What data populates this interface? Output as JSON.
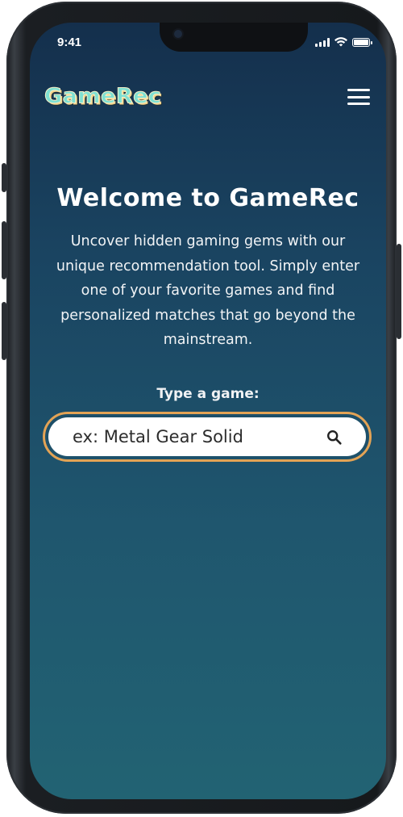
{
  "status_bar": {
    "time": "9:41"
  },
  "header": {
    "logo": "GameRec",
    "menu_icon": "hamburger-menu-icon"
  },
  "hero": {
    "title": "Welcome to GameRec",
    "description": "Uncover hidden gaming gems with our unique recommendation tool. Simply enter one of your favorite games and find personalized matches that go beyond the mainstream."
  },
  "search": {
    "label": "Type a game:",
    "placeholder": "ex: Metal Gear Solid",
    "icon": "search-icon"
  },
  "colors": {
    "background_top": "#142f4c",
    "background_bottom": "#226373",
    "search_border": "#e3a355",
    "logo_fill": "#7ee0d2"
  }
}
